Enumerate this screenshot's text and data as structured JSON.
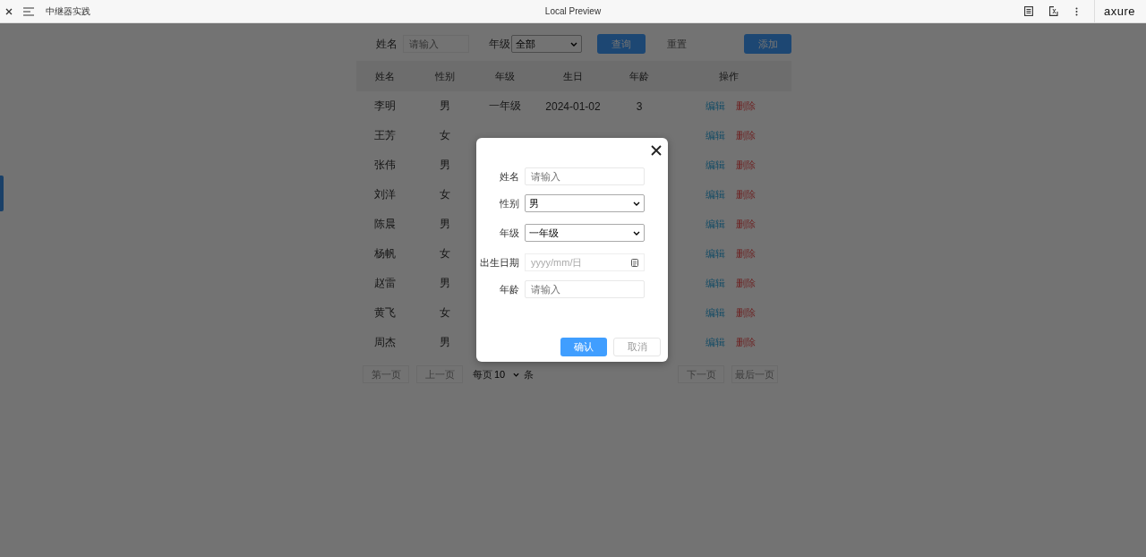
{
  "window": {
    "title": "中继器实践",
    "center_title": "Local Preview",
    "brand": "axure"
  },
  "filters": {
    "name_label": "姓名",
    "name_placeholder": "请输入",
    "grade_label": "年级",
    "grade_value": "全部"
  },
  "buttons": {
    "query": "查询",
    "reset": "重置",
    "add": "添加"
  },
  "table": {
    "columns": [
      "姓名",
      "性别",
      "年级",
      "生日",
      "年龄",
      "操作"
    ],
    "rows": [
      {
        "name": "李明",
        "gender": "男",
        "grade": "一年级",
        "birthday": "2024-01-02",
        "age": "3",
        "edit": "编辑",
        "delete": "删除"
      },
      {
        "name": "王芳",
        "gender": "女",
        "edit": "编辑",
        "delete": "删除"
      },
      {
        "name": "张伟",
        "gender": "男",
        "edit": "编辑",
        "delete": "删除"
      },
      {
        "name": "刘洋",
        "gender": "女",
        "edit": "编辑",
        "delete": "删除"
      },
      {
        "name": "陈晨",
        "gender": "男",
        "edit": "编辑",
        "delete": "删除"
      },
      {
        "name": "杨帆",
        "gender": "女",
        "edit": "编辑",
        "delete": "删除"
      },
      {
        "name": "赵雷",
        "gender": "男",
        "edit": "编辑",
        "delete": "删除"
      },
      {
        "name": "黄飞",
        "gender": "女",
        "edit": "编辑",
        "delete": "删除"
      },
      {
        "name": "周杰",
        "gender": "男",
        "edit": "编辑",
        "delete": "删除"
      }
    ]
  },
  "pagination": {
    "first": "第一页",
    "prev": "上一页",
    "per_page_label": "每页",
    "per_page": "10",
    "unit": "条",
    "next": "下一页",
    "last": "最后一页"
  },
  "dialog": {
    "fields": [
      {
        "kind": "text",
        "label": "姓名",
        "placeholder": "请输入"
      },
      {
        "kind": "select",
        "label": "性别",
        "value": "男"
      },
      {
        "kind": "select",
        "label": "年级",
        "value": "一年级"
      },
      {
        "kind": "date",
        "label": "出生日期",
        "placeholder": "yyyy/mm/日"
      },
      {
        "kind": "text",
        "label": "年龄",
        "placeholder": "请输入"
      }
    ],
    "confirm": "确认",
    "cancel": "取消"
  }
}
